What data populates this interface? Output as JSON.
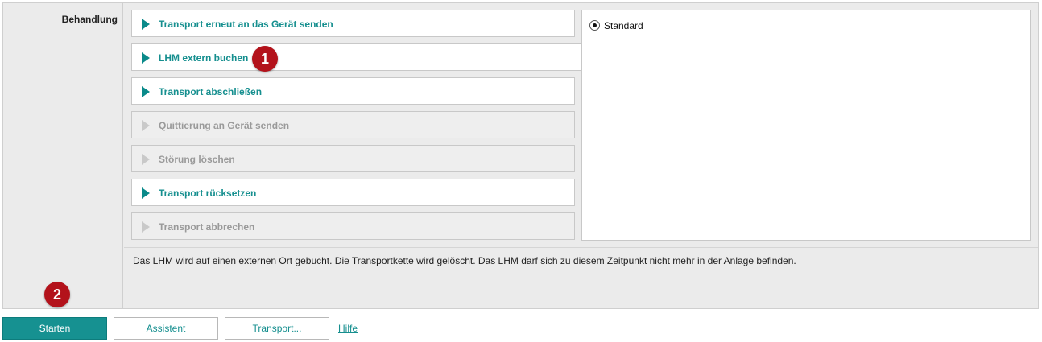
{
  "section": {
    "label": "Behandlung"
  },
  "options": [
    {
      "label": "Transport erneut an das Gerät senden",
      "state": "enabled"
    },
    {
      "label": "LHM extern buchen",
      "state": "selected"
    },
    {
      "label": "Transport abschließen",
      "state": "enabled"
    },
    {
      "label": "Quittierung an Gerät senden",
      "state": "disabled"
    },
    {
      "label": "Störung löschen",
      "state": "disabled"
    },
    {
      "label": "Transport rücksetzen",
      "state": "enabled"
    },
    {
      "label": "Transport abbrechen",
      "state": "disabled"
    }
  ],
  "detail": {
    "radio_label": "Standard",
    "radio_checked": true
  },
  "description": "Das LHM wird auf einen externen Ort gebucht. Die Transportkette wird gelöscht. Das LHM darf sich zu diesem Zeitpunkt nicht mehr in der Anlage befinden.",
  "badges": {
    "first": "1",
    "second": "2"
  },
  "buttons": {
    "start_label": "Starten",
    "assistant_label": "Assistent",
    "transport_label": "Transport...",
    "help_label": "Hilfe"
  },
  "colors": {
    "accent": "#169191",
    "accent_text": "#168f8f",
    "badge": "#b3121b",
    "frame_bg": "#ebebeb"
  },
  "icons": {
    "option_arrow": "triangle-right-icon",
    "radio": "radio-selected-icon"
  }
}
